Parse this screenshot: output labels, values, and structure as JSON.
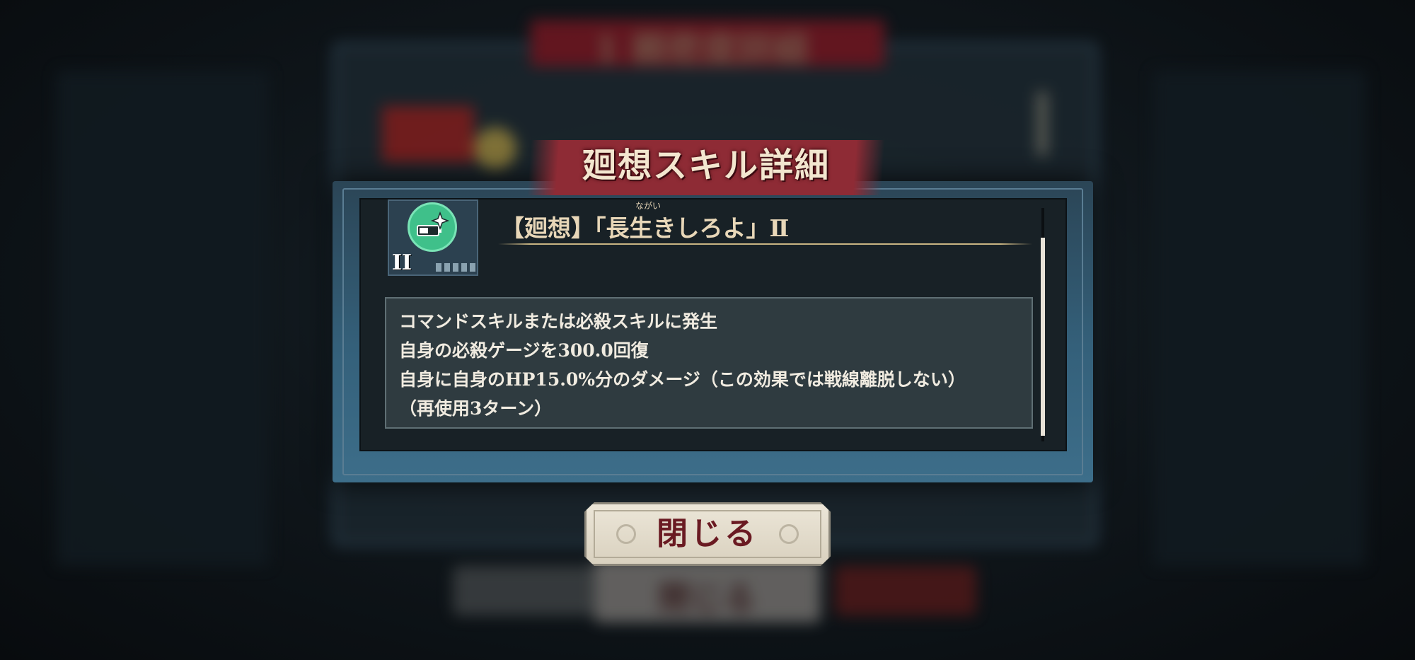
{
  "background": {
    "banner_text": "1 親密度詳細",
    "close_button_text": "閉じる"
  },
  "modal": {
    "title": "廻想スキル詳細",
    "skill": {
      "icon": "battery-sparkle-icon",
      "icon_color": "#3fc08a",
      "level_badge": "II",
      "ruby": "ながい",
      "name": "【廻想】「長生きしろよ」Ⅱ"
    },
    "description_lines": [
      "コマンドスキルまたは必殺スキルに発生",
      "自身の必殺ゲージを300.0回復",
      "自身に自身のHP15.0%分のダメージ（この効果では戦線離脱しない）",
      "（再使用3ターン）"
    ]
  },
  "close_button": {
    "label": "閉じる"
  },
  "colors": {
    "title_banner": "#8e2b35",
    "frame": "#34607a",
    "button_text": "#6a1a22"
  }
}
